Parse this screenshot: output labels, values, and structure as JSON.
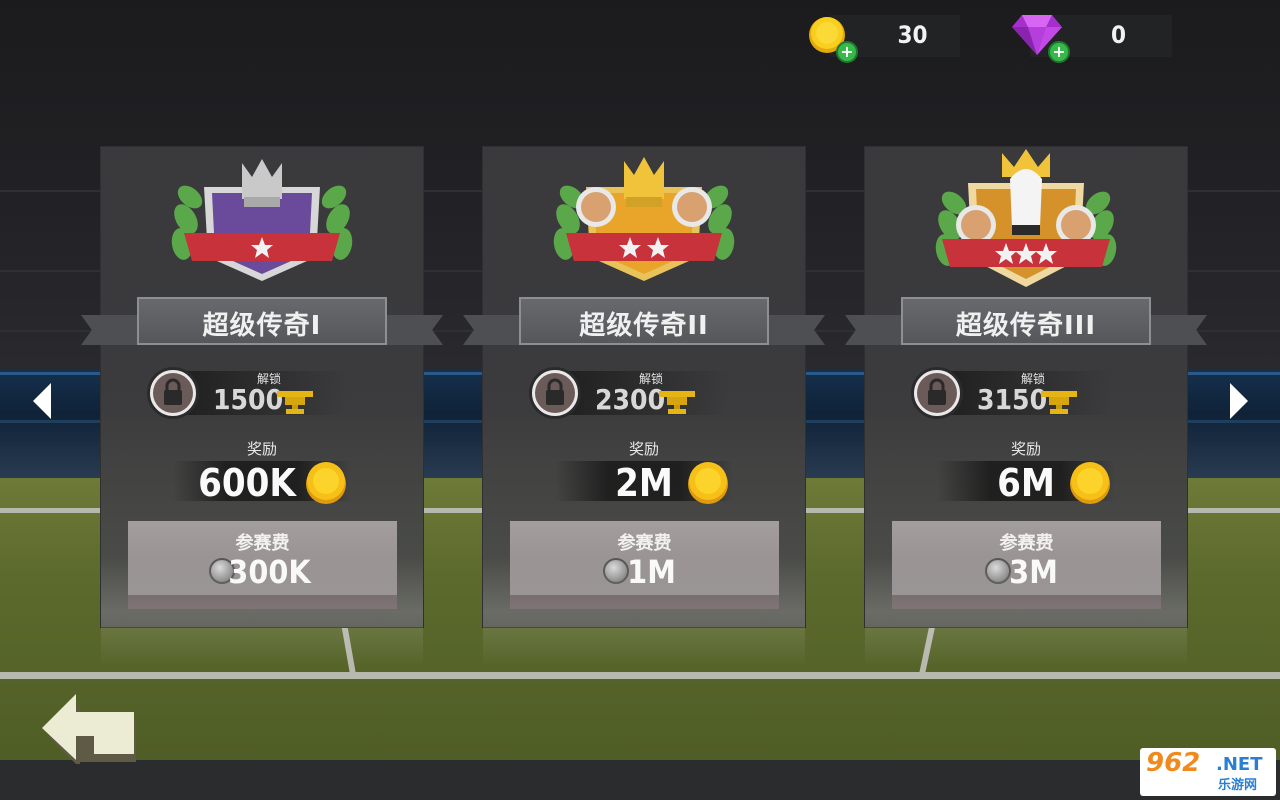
{
  "currency": {
    "coins": {
      "value": "30",
      "icon": "gold-coin-icon"
    },
    "gems": {
      "value": "0",
      "icon": "purple-diamond-icon"
    }
  },
  "tournaments": [
    {
      "title": "超级传奇I",
      "unlock_label": "解锁",
      "unlock_trophies": "1500",
      "reward_label": "奖励",
      "reward": "600K",
      "fee_label": "参赛费",
      "fee": "300K",
      "stars": 1
    },
    {
      "title": "超级传奇II",
      "unlock_label": "解锁",
      "unlock_trophies": "2300",
      "reward_label": "奖励",
      "reward": "2M",
      "fee_label": "参赛费",
      "fee": "1M",
      "stars": 2
    },
    {
      "title": "超级传奇III",
      "unlock_label": "解锁",
      "unlock_trophies": "3150",
      "reward_label": "奖励",
      "reward": "6M",
      "fee_label": "参赛费",
      "fee": "3M",
      "stars": 3
    }
  ],
  "watermark": {
    "brand": "962",
    "suffix": ".NET",
    "site": "乐游网"
  },
  "colors": {
    "coin": "#f6c019",
    "gem": "#b03bd6",
    "plus": "#37b84a"
  }
}
